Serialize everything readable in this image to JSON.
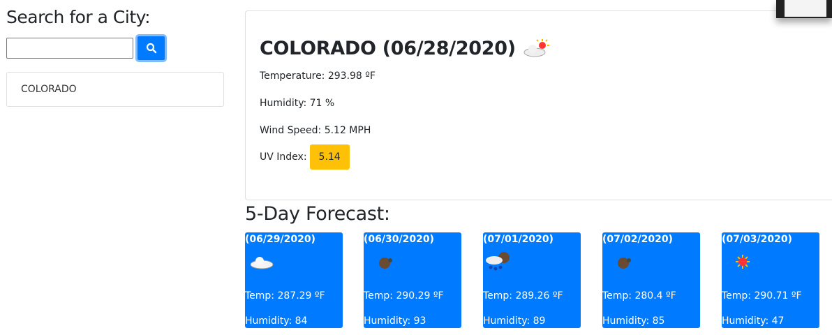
{
  "search": {
    "heading": "Search for a City:",
    "value": "",
    "placeholder": ""
  },
  "history": [
    "COLORADO"
  ],
  "current": {
    "title": "COLORADO (06/28/2020)",
    "icon": "partly-cloudy",
    "temperature": "Temperature: 293.98 ºF",
    "humidity": "Humidity: 71 %",
    "wind": "Wind Speed: 5.12 MPH",
    "uv_label": "UV Index:",
    "uv_value": "5.14",
    "uv_color": "#ffc107"
  },
  "forecast_heading": "5-Day Forecast:",
  "forecast": [
    {
      "date": "(06/29/2020)",
      "icon": "cloud",
      "temp": "Temp: 287.29 ºF",
      "humidity": "Humidity: 84"
    },
    {
      "date": "(06/30/2020)",
      "icon": "broken-clouds",
      "temp": "Temp: 290.29 ºF",
      "humidity": "Humidity: 93"
    },
    {
      "date": "(07/01/2020)",
      "icon": "rain",
      "temp": "Temp: 289.26 ºF",
      "humidity": "Humidity: 89"
    },
    {
      "date": "(07/02/2020)",
      "icon": "broken-clouds",
      "temp": "Temp: 280.4 ºF",
      "humidity": "Humidity: 85"
    },
    {
      "date": "(07/03/2020)",
      "icon": "sun",
      "temp": "Temp: 290.71 ºF",
      "humidity": "Humidity: 47"
    }
  ],
  "accent": "#007bff"
}
